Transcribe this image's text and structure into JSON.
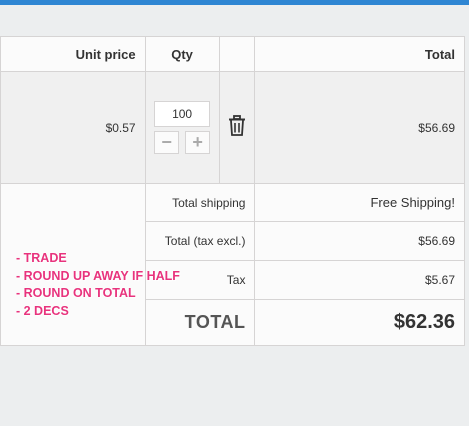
{
  "table": {
    "headers": {
      "unit_price": "Unit price",
      "qty": "Qty",
      "total": "Total"
    },
    "item": {
      "unit_price": "$0.57",
      "quantity": "100",
      "decrement": "−",
      "increment": "+",
      "total": "$56.69"
    }
  },
  "summary": {
    "shipping_label": "Total shipping",
    "shipping_value": "Free Shipping!",
    "total_excl_label": "Total (tax excl.)",
    "total_excl_value": "$56.69",
    "tax_label": "Tax",
    "tax_value": "$5.67",
    "grand_label": "TOTAL",
    "grand_value": "$62.36"
  },
  "notes": [
    "- TRADE",
    "- ROUND UP AWAY IF HALF",
    "- ROUND ON TOTAL",
    "- 2 DECS"
  ],
  "colors": {
    "accent": "#2f86d3",
    "note": "#e8337d",
    "border": "#d6d4d4"
  },
  "icons": {
    "delete": "trash-icon"
  }
}
